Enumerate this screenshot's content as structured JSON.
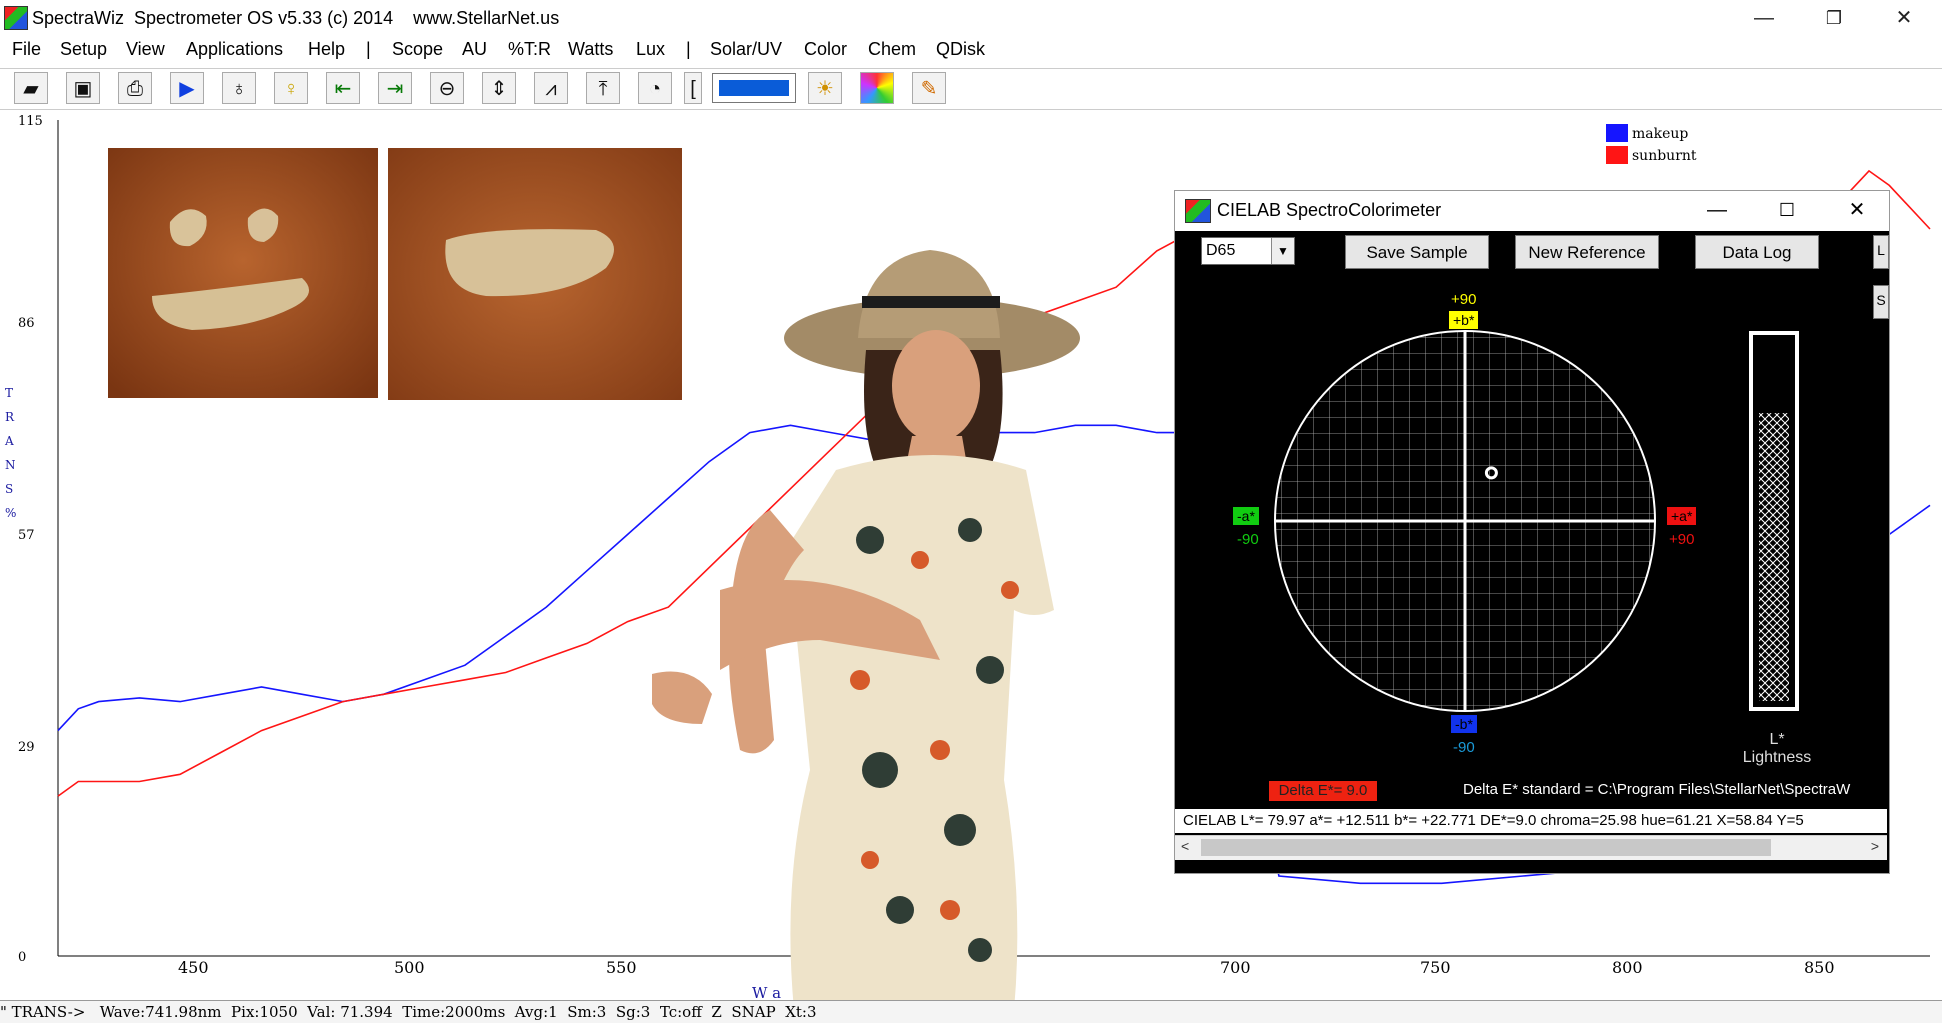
{
  "window": {
    "title": "SpectraWiz  Spectrometer OS v5.33 (c) 2014    www.StellarNet.us",
    "minimize": "—",
    "restore": "❐",
    "close": "✕"
  },
  "menu": [
    "File",
    "Setup",
    "View",
    "Applications",
    "Help",
    "|",
    "Scope",
    "AU",
    "%T:R",
    "Watts",
    "Lux",
    "|",
    "Solar/UV",
    "Color",
    "Chem",
    "QDisk"
  ],
  "toolbar": {
    "icons": [
      "open-icon",
      "save-icon",
      "print-icon",
      "play-icon",
      "bulb-dark-icon",
      "bulb-light-icon",
      "left-limit-icon",
      "right-limit-icon",
      "zoom-icon",
      "autoscale-icon",
      "peak-icon",
      "upload-icon",
      "timer-icon",
      "color-bar-icon",
      "sun-icon",
      "color-wheel-icon",
      "paint-icon"
    ]
  },
  "legend": [
    {
      "label": "makeup",
      "color": "#1515ff"
    },
    {
      "label": "sunburnt",
      "color": "#ff1515"
    }
  ],
  "y_axis": {
    "label_chars": [
      "T",
      "R",
      "A",
      "N",
      "S",
      "%"
    ],
    "ticks": [
      "115",
      "86",
      "57",
      "29",
      "0"
    ]
  },
  "x_axis": {
    "ticks": [
      "450",
      "500",
      "550",
      "700",
      "750",
      "800",
      "850"
    ],
    "label_fragment": "W a"
  },
  "chart_data": {
    "type": "line",
    "xlim": [
      420,
      880
    ],
    "ylim": [
      0,
      115
    ],
    "series": [
      {
        "name": "makeup",
        "color": "#1515ff",
        "x": [
          420,
          425,
          430,
          440,
          450,
          460,
          470,
          480,
          490,
          500,
          510,
          520,
          530,
          540,
          550,
          560,
          570,
          580,
          590,
          600,
          610,
          620,
          630,
          640,
          650,
          660,
          670,
          680,
          690,
          700,
          720,
          740,
          760,
          780,
          800,
          820,
          840,
          860,
          870,
          880
        ],
        "y": [
          31,
          34,
          35,
          35.5,
          35,
          36,
          37,
          36,
          35,
          36,
          38,
          40,
          44,
          48,
          53,
          58,
          63,
          68,
          72,
          73,
          72,
          71,
          72,
          73,
          72,
          72,
          73,
          73,
          72,
          72,
          11,
          10,
          10,
          11,
          12,
          13,
          20,
          60,
          58,
          62
        ]
      },
      {
        "name": "sunburnt",
        "color": "#ff1515",
        "x": [
          420,
          425,
          430,
          440,
          450,
          460,
          470,
          480,
          490,
          500,
          510,
          520,
          530,
          540,
          550,
          560,
          570,
          640,
          660,
          680,
          690,
          700,
          760,
          800,
          840,
          860,
          865,
          870,
          880
        ],
        "y": [
          22,
          24,
          24,
          24,
          25,
          28,
          31,
          33,
          35,
          36,
          37,
          38,
          39,
          41,
          43,
          46,
          48,
          86,
          88,
          92,
          97,
          100,
          100,
          100,
          100,
          105,
          108,
          106,
          100
        ]
      }
    ]
  },
  "status": "\" TRANS->   Wave:741.98nm  Pix:1050  Val: 71.394  Time:2000ms  Avg:1  Sm:3  Sg:3  Tc:off  Z  SNAP  Xt:3",
  "cielab": {
    "title": "CIELAB SpectroColorimeter",
    "illuminant": "D65",
    "buttons": {
      "save": "Save Sample",
      "new_ref": "New Reference",
      "data_log": "Data Log"
    },
    "side_buttons": [
      "L",
      "S"
    ],
    "axis_labels": {
      "plus_b_num": "+90",
      "plus_b": "+b*",
      "minus_a": "-a*",
      "minus_a_num": "-90",
      "plus_a": "+a*",
      "plus_a_num": "+90",
      "minus_b": "-b*",
      "minus_b_num": "-90"
    },
    "sample_point": {
      "a": 12.511,
      "b": 22.771
    },
    "lightness": {
      "value": 79.97,
      "label_top": "L*",
      "label_bottom": "Lightness"
    },
    "delta_e": "Delta E*= 9.0",
    "delta_standard": "Delta E* standard = C:\\Program Files\\StellarNet\\SpectraW",
    "status": "CIELAB L*= 79.97  a*= +12.511  b*= +22.771  DE*=9.0  chroma=25.98  hue=61.21  X=58.84  Y=5",
    "scroll_left": "<",
    "scroll_right": ">"
  }
}
